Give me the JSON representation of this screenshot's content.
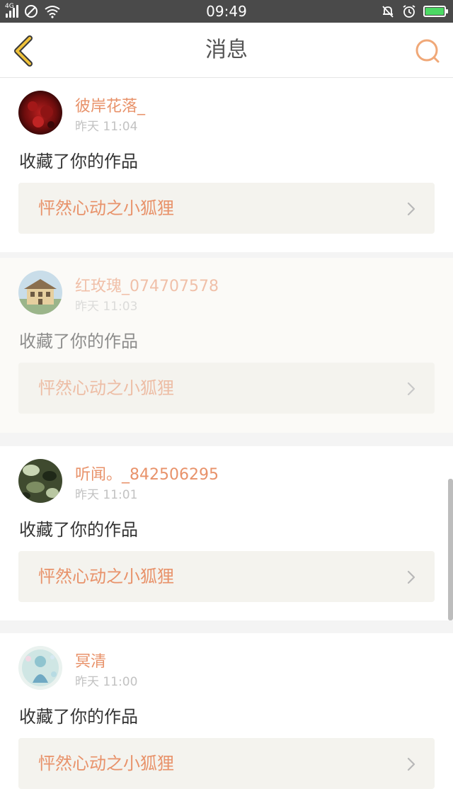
{
  "status_bar": {
    "network": "4G",
    "time": "09:49",
    "icons": [
      "signal-icon",
      "do-not-disturb-icon",
      "wifi-icon",
      "mute-bell-icon",
      "alarm-icon",
      "battery-charging-icon"
    ],
    "battery_color": "#4cd964"
  },
  "header": {
    "title": "消息",
    "back_icon": "chevron-left-icon",
    "search_icon": "search-icon",
    "accent": "#f0b63a"
  },
  "notifications": [
    {
      "user": "彼岸花落_",
      "time": "昨天 11:04",
      "action": "收藏了你的作品",
      "work": "怦然心动之小狐狸",
      "avatar": "avatar-red-flowers"
    },
    {
      "user": "红玫瑰_074707578",
      "time": "昨天 11:03",
      "action": "收藏了你的作品",
      "work": "怦然心动之小狐狸",
      "avatar": "avatar-house"
    },
    {
      "user": "听闻。_842506295",
      "time": "昨天 11:01",
      "action": "收藏了你的作品",
      "work": "怦然心动之小狐狸",
      "avatar": "avatar-green-camo"
    },
    {
      "user": "冥清",
      "time": "昨天 11:00",
      "action": "收藏了你的作品",
      "work": "怦然心动之小狐狸",
      "avatar": "avatar-blue-figure"
    }
  ],
  "colors": {
    "username": "#e8926a",
    "timestamp": "#c2c2c2",
    "work_bg": "#f4f3ee"
  }
}
